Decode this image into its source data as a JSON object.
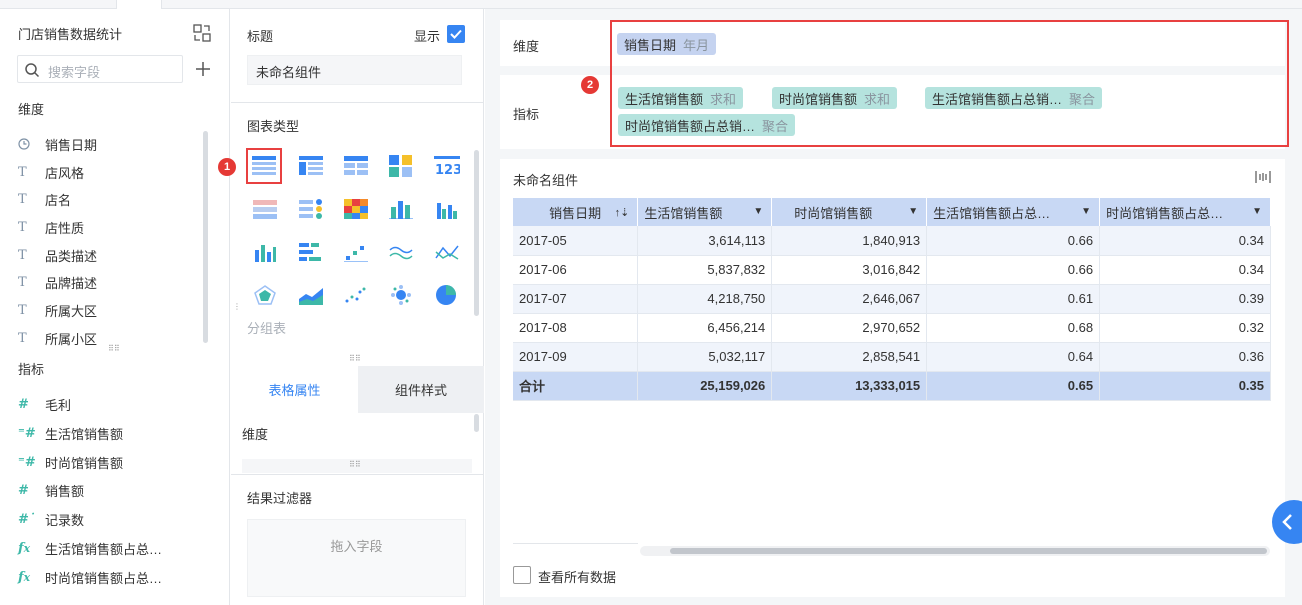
{
  "left": {
    "dataset_title": "门店销售数据统计",
    "search_placeholder": "搜索字段",
    "dimension_label": "维度",
    "dimensions": [
      "销售日期",
      "店风格",
      "店名",
      "店性质",
      "品类描述",
      "品牌描述",
      "所属大区",
      "所属小区"
    ],
    "measure_label": "指标",
    "measures": [
      "毛利",
      "生活馆销售额",
      "时尚馆销售额",
      "销售额",
      "记录数",
      "生活馆销售额占总…",
      "时尚馆销售额占总…"
    ]
  },
  "mid": {
    "title_label": "标题",
    "show_label": "显示",
    "title_value": "未命名组件",
    "chart_type_label": "图表类型",
    "group_table_label": "分组表",
    "tab_table_props": "表格属性",
    "tab_component_style": "组件样式",
    "dimension_label": "维度",
    "filter_label": "结果过滤器",
    "drop_hint": "拖入字段",
    "badge1": "1"
  },
  "right": {
    "dimension_label": "维度",
    "measure_label": "指标",
    "dimension_pill": {
      "name": "销售日期",
      "sub": "年月"
    },
    "measure_pills": [
      {
        "name": "生活馆销售额",
        "sub": "求和"
      },
      {
        "name": "时尚馆销售额",
        "sub": "求和"
      },
      {
        "name": "生活馆销售额占总销…",
        "sub": "聚合"
      },
      {
        "name": "时尚馆销售额占总销…",
        "sub": "聚合"
      }
    ],
    "badge2": "2",
    "component_title": "未命名组件",
    "view_all_label": "查看所有数据",
    "table": {
      "headers": [
        "销售日期",
        "生活馆销售额",
        "时尚馆销售额",
        "生活馆销售额占总…",
        "时尚馆销售额占总…"
      ],
      "rows": [
        [
          "2017-05",
          "3,614,113",
          "1,840,913",
          "0.66",
          "0.34"
        ],
        [
          "2017-06",
          "5,837,832",
          "3,016,842",
          "0.66",
          "0.34"
        ],
        [
          "2017-07",
          "4,218,750",
          "2,646,067",
          "0.61",
          "0.39"
        ],
        [
          "2017-08",
          "6,456,214",
          "2,970,652",
          "0.68",
          "0.32"
        ],
        [
          "2017-09",
          "5,032,117",
          "2,858,541",
          "0.64",
          "0.36"
        ]
      ],
      "total": [
        "合计",
        "25,159,026",
        "13,333,015",
        "0.65",
        "0.35"
      ]
    }
  },
  "colors": {
    "accent": "#3685f2",
    "highlight": "#e84040",
    "dim_pill": "#c5d3f0",
    "measure_pill": "#b5e3de",
    "table_header": "#c8d8f4"
  }
}
